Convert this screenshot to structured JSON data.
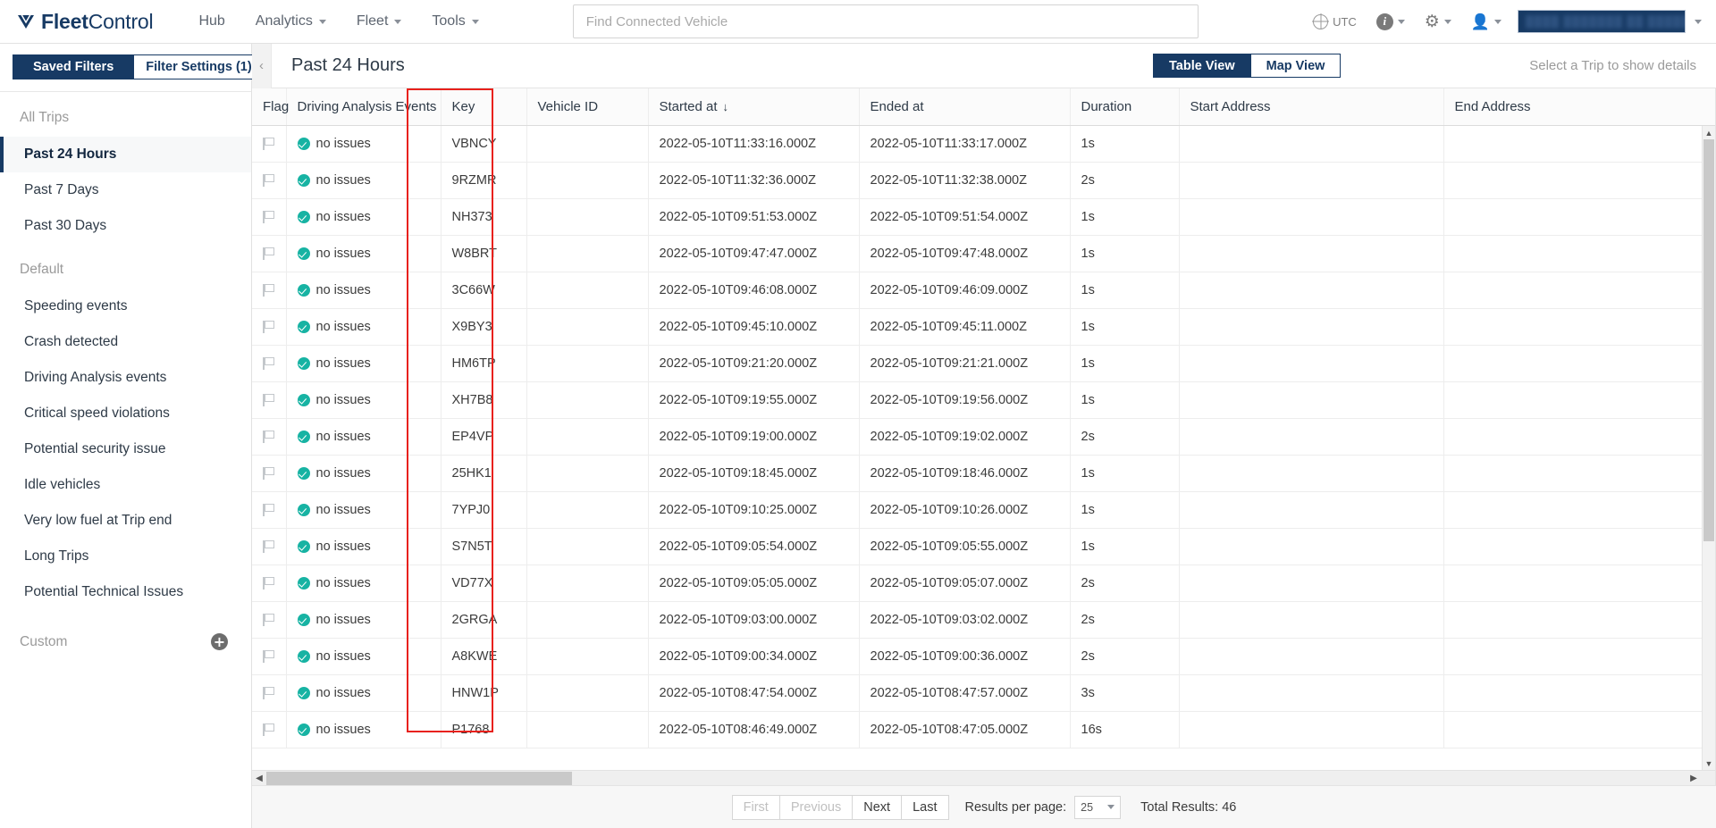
{
  "topnav": {
    "brand": {
      "bold": "Fleet",
      "regular": "Control",
      "logo_icon": "fleetcontrol-logo-icon"
    },
    "items": [
      {
        "label": "Hub",
        "has_caret": false
      },
      {
        "label": "Analytics",
        "has_caret": true
      },
      {
        "label": "Fleet",
        "has_caret": true
      },
      {
        "label": "Tools",
        "has_caret": true
      }
    ],
    "search": {
      "placeholder": "Find Connected Vehicle",
      "value": ""
    },
    "timezone": "UTC",
    "account_field_value": "████ ███████ ██ ███████ ███"
  },
  "sidebar": {
    "tabs": [
      {
        "label": "Saved Filters",
        "active": true
      },
      {
        "label": "Filter Settings (1)",
        "active": false
      }
    ],
    "group_all_trips_label": "All Trips",
    "all_trips": [
      {
        "label": "Past 24 Hours",
        "selected": true
      },
      {
        "label": "Past 7 Days",
        "selected": false
      },
      {
        "label": "Past 30 Days",
        "selected": false
      }
    ],
    "group_default_label": "Default",
    "default_items": [
      {
        "label": "Speeding events"
      },
      {
        "label": "Crash detected"
      },
      {
        "label": "Driving Analysis events"
      },
      {
        "label": "Critical speed violations"
      },
      {
        "label": "Potential security issue"
      },
      {
        "label": "Idle vehicles"
      },
      {
        "label": "Very low fuel at Trip end"
      },
      {
        "label": "Long Trips"
      },
      {
        "label": "Potential Technical Issues"
      }
    ],
    "group_custom_label": "Custom",
    "add_custom_icon": "plus-circle-icon"
  },
  "content_header": {
    "collapse_icon": "chevron-left-icon",
    "title": "Past 24 Hours",
    "views": [
      {
        "label": "Table View",
        "active": true
      },
      {
        "label": "Map View",
        "active": false
      }
    ],
    "detail_hint": "Select a Trip to show details"
  },
  "table": {
    "columns": [
      {
        "key": "flag",
        "label": "Flag",
        "cls": "c-flag"
      },
      {
        "key": "events",
        "label": "Driving Analysis Events",
        "cls": "c-events"
      },
      {
        "key": "trip_key",
        "label": "Key",
        "cls": "c-key",
        "highlighted": true
      },
      {
        "key": "vehicle_id",
        "label": "Vehicle ID",
        "cls": "c-vid"
      },
      {
        "key": "started_at",
        "label": "Started at",
        "cls": "c-start",
        "sorted": "desc"
      },
      {
        "key": "ended_at",
        "label": "Ended at",
        "cls": "c-end"
      },
      {
        "key": "duration",
        "label": "Duration",
        "cls": "c-dur"
      },
      {
        "key": "start_address",
        "label": "Start Address",
        "cls": "c-saddr"
      },
      {
        "key": "end_address",
        "label": "End Address",
        "cls": "c-eaddr"
      }
    ],
    "sort_desc_glyph": "↓",
    "status_label": "no issues",
    "flag_icon": "flag-outline-icon",
    "status_icon": "check-circle-icon",
    "rows": [
      {
        "events": "no issues",
        "trip_key": "VBNCY",
        "vehicle_id": "",
        "started_at": "2022-05-10T11:33:16.000Z",
        "ended_at": "2022-05-10T11:33:17.000Z",
        "duration": "1s",
        "start_address": "",
        "end_address": ""
      },
      {
        "events": "no issues",
        "trip_key": "9RZMR",
        "vehicle_id": "",
        "started_at": "2022-05-10T11:32:36.000Z",
        "ended_at": "2022-05-10T11:32:38.000Z",
        "duration": "2s",
        "start_address": "",
        "end_address": ""
      },
      {
        "events": "no issues",
        "trip_key": "NH373",
        "vehicle_id": "",
        "started_at": "2022-05-10T09:51:53.000Z",
        "ended_at": "2022-05-10T09:51:54.000Z",
        "duration": "1s",
        "start_address": "",
        "end_address": ""
      },
      {
        "events": "no issues",
        "trip_key": "W8BRT",
        "vehicle_id": "",
        "started_at": "2022-05-10T09:47:47.000Z",
        "ended_at": "2022-05-10T09:47:48.000Z",
        "duration": "1s",
        "start_address": "",
        "end_address": ""
      },
      {
        "events": "no issues",
        "trip_key": "3C66W",
        "vehicle_id": "",
        "started_at": "2022-05-10T09:46:08.000Z",
        "ended_at": "2022-05-10T09:46:09.000Z",
        "duration": "1s",
        "start_address": "",
        "end_address": ""
      },
      {
        "events": "no issues",
        "trip_key": "X9BY3",
        "vehicle_id": "",
        "started_at": "2022-05-10T09:45:10.000Z",
        "ended_at": "2022-05-10T09:45:11.000Z",
        "duration": "1s",
        "start_address": "",
        "end_address": ""
      },
      {
        "events": "no issues",
        "trip_key": "HM6TP",
        "vehicle_id": "",
        "started_at": "2022-05-10T09:21:20.000Z",
        "ended_at": "2022-05-10T09:21:21.000Z",
        "duration": "1s",
        "start_address": "",
        "end_address": ""
      },
      {
        "events": "no issues",
        "trip_key": "XH7B8",
        "vehicle_id": "",
        "started_at": "2022-05-10T09:19:55.000Z",
        "ended_at": "2022-05-10T09:19:56.000Z",
        "duration": "1s",
        "start_address": "",
        "end_address": ""
      },
      {
        "events": "no issues",
        "trip_key": "EP4VP",
        "vehicle_id": "",
        "started_at": "2022-05-10T09:19:00.000Z",
        "ended_at": "2022-05-10T09:19:02.000Z",
        "duration": "2s",
        "start_address": "",
        "end_address": ""
      },
      {
        "events": "no issues",
        "trip_key": "25HK1",
        "vehicle_id": "",
        "started_at": "2022-05-10T09:18:45.000Z",
        "ended_at": "2022-05-10T09:18:46.000Z",
        "duration": "1s",
        "start_address": "",
        "end_address": ""
      },
      {
        "events": "no issues",
        "trip_key": "7YPJ0",
        "vehicle_id": "",
        "started_at": "2022-05-10T09:10:25.000Z",
        "ended_at": "2022-05-10T09:10:26.000Z",
        "duration": "1s",
        "start_address": "",
        "end_address": ""
      },
      {
        "events": "no issues",
        "trip_key": "S7N5T",
        "vehicle_id": "",
        "started_at": "2022-05-10T09:05:54.000Z",
        "ended_at": "2022-05-10T09:05:55.000Z",
        "duration": "1s",
        "start_address": "",
        "end_address": ""
      },
      {
        "events": "no issues",
        "trip_key": "VD77X",
        "vehicle_id": "",
        "started_at": "2022-05-10T09:05:05.000Z",
        "ended_at": "2022-05-10T09:05:07.000Z",
        "duration": "2s",
        "start_address": "",
        "end_address": ""
      },
      {
        "events": "no issues",
        "trip_key": "2GRGA",
        "vehicle_id": "",
        "started_at": "2022-05-10T09:03:00.000Z",
        "ended_at": "2022-05-10T09:03:02.000Z",
        "duration": "2s",
        "start_address": "",
        "end_address": ""
      },
      {
        "events": "no issues",
        "trip_key": "A8KWE",
        "vehicle_id": "",
        "started_at": "2022-05-10T09:00:34.000Z",
        "ended_at": "2022-05-10T09:00:36.000Z",
        "duration": "2s",
        "start_address": "",
        "end_address": ""
      },
      {
        "events": "no issues",
        "trip_key": "HNW1P",
        "vehicle_id": "",
        "started_at": "2022-05-10T08:47:54.000Z",
        "ended_at": "2022-05-10T08:47:57.000Z",
        "duration": "3s",
        "start_address": "",
        "end_address": ""
      },
      {
        "events": "no issues",
        "trip_key": "P1768",
        "vehicle_id": "",
        "started_at": "2022-05-10T08:46:49.000Z",
        "ended_at": "2022-05-10T08:47:05.000Z",
        "duration": "16s",
        "start_address": "",
        "end_address": ""
      }
    ]
  },
  "footer": {
    "buttons": [
      {
        "label": "First",
        "disabled": true
      },
      {
        "label": "Previous",
        "disabled": true
      },
      {
        "label": "Next",
        "disabled": false
      },
      {
        "label": "Last",
        "disabled": false
      }
    ],
    "results_per_page_label": "Results per page:",
    "results_per_page_value": "25",
    "total_results": "Total Results: 46"
  },
  "colors": {
    "brand_navy": "#173a64",
    "status_teal": "#17b3a3",
    "highlight_red": "#e8211c"
  }
}
